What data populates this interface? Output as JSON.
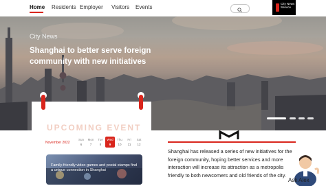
{
  "nav": {
    "items": [
      "Home",
      "Residents",
      "Employer",
      "Visitors",
      "Events"
    ],
    "active": "Home"
  },
  "logo": {
    "text": "City News Service"
  },
  "hero": {
    "section": "City News",
    "headline": "Shanghai to better serve foreign community with new initiatives"
  },
  "event": {
    "title": "UPCOMING EVENT",
    "month": "November 2022",
    "weekdays": [
      "Sun",
      "Mon",
      "Tue",
      "Wed",
      "Thu",
      "Fri",
      "Sat"
    ],
    "days": [
      "6",
      "7",
      "8",
      "9",
      "10",
      "11",
      "12"
    ],
    "selected_day": "9",
    "item_text": "Family-friendly video games and postal stamps find a unique connection in Shanghai"
  },
  "article": {
    "text": "Shanghai has released a series of new initiatives for the foreign community, hoping better services and more interaction will increase its attraction as a metropolis friendly to both newcomers and old friends of the city."
  },
  "assistant": {
    "label": "Ask Alex"
  },
  "colors": {
    "accent": "#d9251c",
    "nav_bg": "#ffffff"
  }
}
